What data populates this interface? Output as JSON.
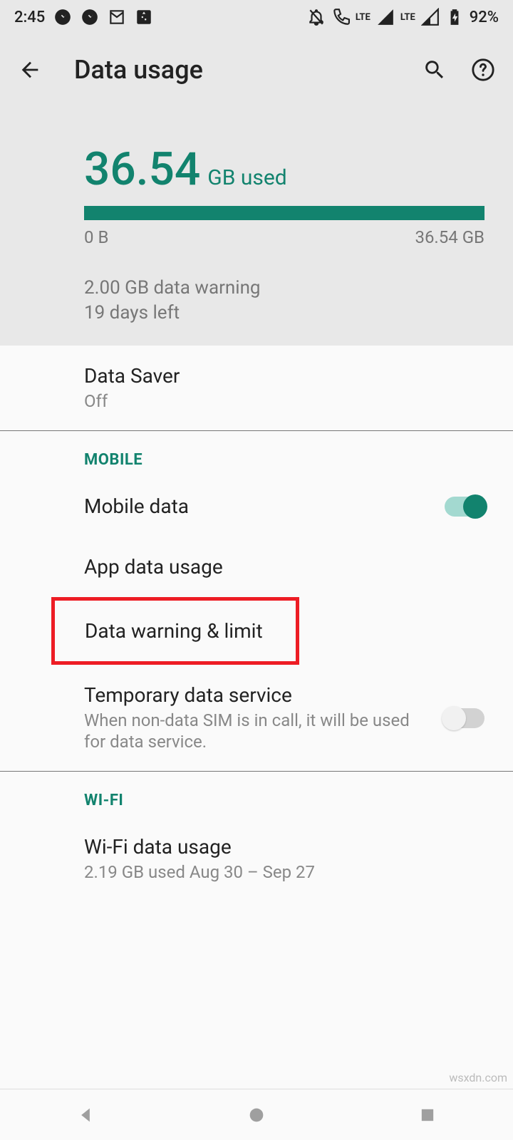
{
  "statusbar": {
    "time": "2:45",
    "battery": "92%",
    "lte": "LTE"
  },
  "header": {
    "title": "Data usage"
  },
  "usage": {
    "amount": "36.54",
    "unit": "GB used",
    "bar_min": "0 B",
    "bar_max": "36.54 GB",
    "warning_line": "2.00 GB data warning",
    "days_left": "19 days left"
  },
  "datasaver": {
    "title": "Data Saver",
    "status": "Off"
  },
  "sections": {
    "mobile": "MOBILE",
    "wifi": "WI-FI"
  },
  "mobile": {
    "mobile_data": "Mobile data",
    "app_data_usage": "App data usage",
    "data_warning_limit": "Data warning & limit",
    "temp_title": "Temporary data service",
    "temp_sub": "When non-data SIM is in call, it will be used for data service."
  },
  "wifi": {
    "title": "Wi-Fi data usage",
    "sub": "2.19 GB used Aug 30 – Sep 27"
  },
  "watermark": "wsxdn.com"
}
